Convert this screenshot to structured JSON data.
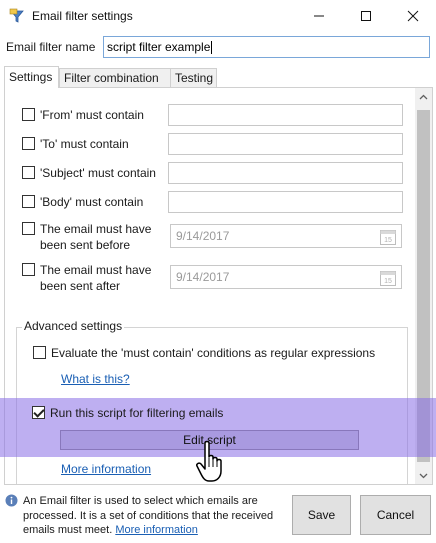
{
  "window": {
    "title": "Email filter settings",
    "icon": "email-filter-app-icon",
    "controls": [
      "minimize-icon",
      "maximize-icon",
      "close-icon"
    ]
  },
  "filter_name": {
    "label": "Email filter name",
    "value": "script filter example"
  },
  "tabs": [
    {
      "label": "Settings",
      "active": true
    },
    {
      "label": "Filter combination",
      "active": false
    },
    {
      "label": "Testing",
      "active": false
    }
  ],
  "conditions": [
    {
      "label": "'From' must contain",
      "checked": false,
      "value": ""
    },
    {
      "label": "'To' must contain",
      "checked": false,
      "value": ""
    },
    {
      "label": "'Subject' must contain",
      "checked": false,
      "value": ""
    },
    {
      "label": "'Body' must contain",
      "checked": false,
      "value": ""
    }
  ],
  "date_conditions": [
    {
      "label_line1": "The email must have",
      "label_line2": "been sent before",
      "checked": false,
      "date": "9/14/2017"
    },
    {
      "label_line1": "The email must have",
      "label_line2": "been sent after",
      "checked": false,
      "date": "9/14/2017"
    }
  ],
  "advanced": {
    "title": "Advanced settings",
    "regex_label": "Evaluate the 'must contain' conditions as regular expressions",
    "regex_checked": false,
    "what_is_this": "What is this?",
    "script_label": "Run this script for filtering emails",
    "script_checked": true,
    "edit_script": "Edit script",
    "more_information": "More information"
  },
  "footer": {
    "info_text": "An Email filter is used to select which emails are processed. It is a set of conditions that the received emails must meet.",
    "info_link": "More information",
    "save": "Save",
    "cancel": "Cancel"
  },
  "colors": {
    "highlight": "#886ee6",
    "link": "#1a5fb4",
    "input_focus_border": "#7aa7d9"
  }
}
